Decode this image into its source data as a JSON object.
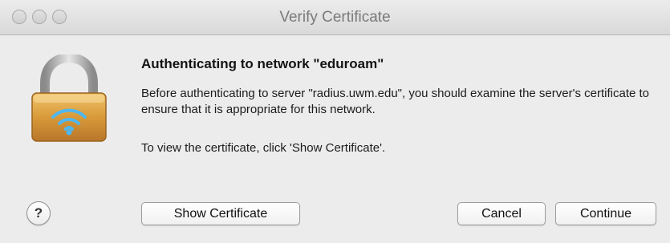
{
  "window": {
    "title": "Verify Certificate"
  },
  "dialog": {
    "heading": "Authenticating to network \"eduroam\"",
    "message": "Before authenticating to server \"radius.uwm.edu\", you should examine the server's certificate to ensure that it is appropriate for this network.",
    "hint": "To view the certificate, click 'Show Certificate'."
  },
  "buttons": {
    "help": "?",
    "show_certificate": "Show Certificate",
    "cancel": "Cancel",
    "continue": "Continue"
  },
  "icons": {
    "lock": "padlock-wifi-icon"
  }
}
